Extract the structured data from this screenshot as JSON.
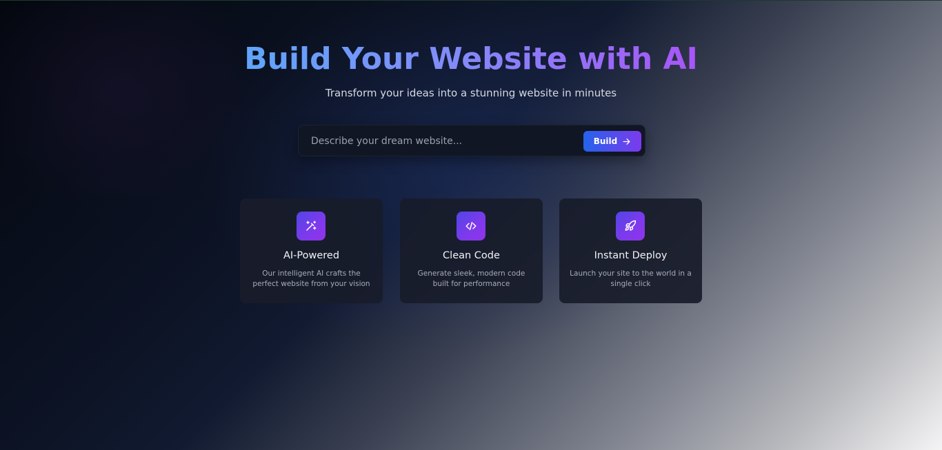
{
  "hero": {
    "title": "Build Your Website with AI",
    "subtitle": "Transform your ideas into a stunning website in minutes"
  },
  "prompt": {
    "placeholder": "Describe your dream website...",
    "value": "",
    "button_label": "Build",
    "button_icon": "arrow-right-icon"
  },
  "features": [
    {
      "icon": "magic-wand-icon",
      "title": "AI-Powered",
      "description": "Our intelligent AI crafts the perfect website from your vision"
    },
    {
      "icon": "code-icon",
      "title": "Clean Code",
      "description": "Generate sleek, modern code built for performance"
    },
    {
      "icon": "rocket-icon",
      "title": "Instant Deploy",
      "description": "Launch your site to the world in a single click"
    }
  ],
  "colors": {
    "gradient_start": "#2563eb",
    "gradient_end": "#7c3aed",
    "title_gradient_start": "#60a5fa",
    "title_gradient_end": "#a855f7",
    "card_background": "#181c2a"
  }
}
